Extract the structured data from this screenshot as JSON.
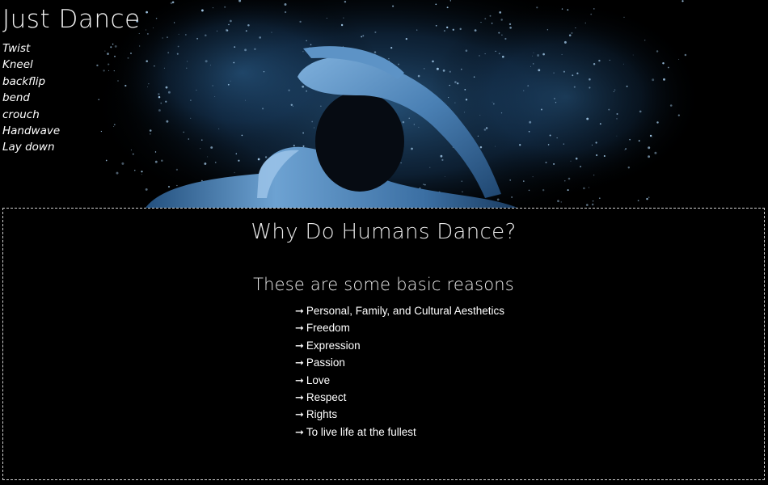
{
  "header": {
    "title": "Just Dance",
    "nav": [
      "Twist",
      "Kneel",
      "backflip",
      "bend",
      "crouch",
      "Handwave",
      "Lay down"
    ]
  },
  "main": {
    "heading": "Why Do Humans Dance?",
    "subheading": "These are some basic reasons",
    "bullet_icon": "arrow-right-icon",
    "reasons": [
      "Personal, Family, and Cultural Aesthetics",
      "Freedom",
      "Expression",
      "Passion",
      "Love",
      "Respect",
      "Rights",
      "To live life at the fullest"
    ]
  },
  "colors": {
    "background": "#000000",
    "accent_blue": "#4a86c0",
    "text": "#ffffff",
    "border": "#cfcfcf"
  }
}
